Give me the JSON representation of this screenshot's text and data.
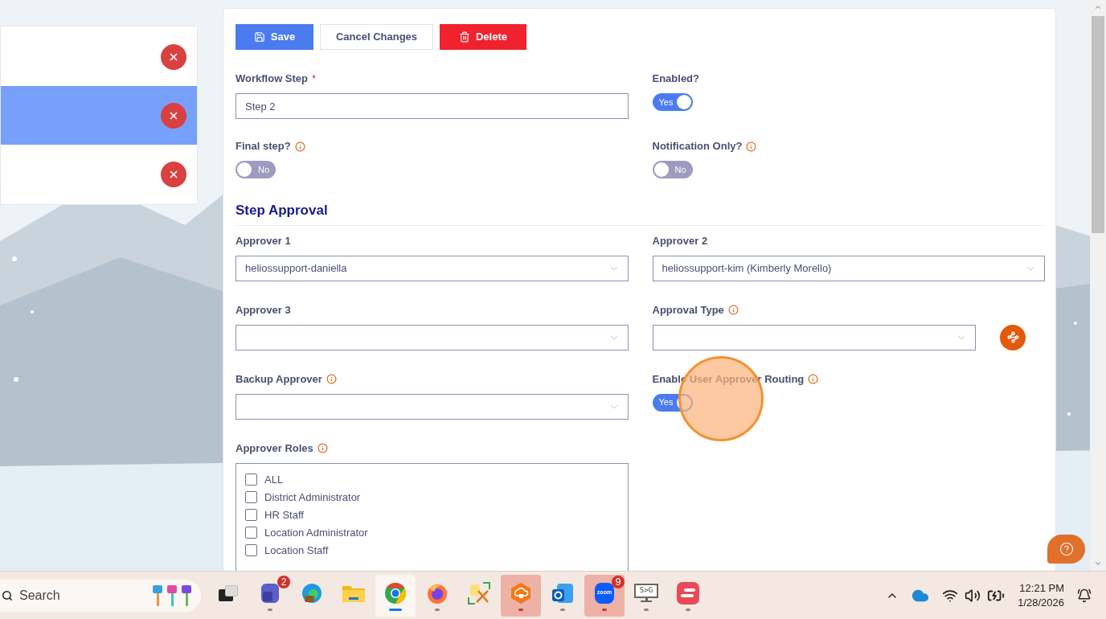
{
  "side_list": {
    "items": [
      {
        "selected": false
      },
      {
        "selected": true
      },
      {
        "selected": false
      }
    ]
  },
  "toolbar": [
    {
      "label": "Save",
      "kind": "primary"
    },
    {
      "label": "Cancel Changes",
      "kind": "secondary"
    },
    {
      "label": "Delete",
      "kind": "danger"
    }
  ],
  "general_fields": [
    {
      "label": "Workflow Step",
      "kind": "text",
      "required_mark": "*",
      "value": "Step 2"
    },
    {
      "label": "Enabled?",
      "kind": "toggle",
      "on": true,
      "toggle_text": "Yes"
    },
    {
      "label": "Final step?",
      "kind": "toggle",
      "info": true,
      "on": false,
      "toggle_text": "No"
    },
    {
      "label": "Notification Only?",
      "kind": "toggle",
      "info": true,
      "on": false,
      "toggle_text": "No"
    }
  ],
  "section_title": "Step Approval",
  "approval_fields": [
    {
      "label": "Approver 1",
      "kind": "select",
      "value": "heliossupport-daniella"
    },
    {
      "label": "Approver 2",
      "kind": "select",
      "value": "heliossupport-kim (Kimberly Morello)"
    },
    {
      "label": "Approver 3",
      "kind": "select"
    },
    {
      "label": "Approval Type",
      "kind": "select",
      "info": true,
      "action_button": true
    },
    {
      "label": "Backup Approver",
      "kind": "select",
      "info": true
    },
    {
      "label": "Enable User Approver Routing",
      "kind": "toggle",
      "info": true,
      "on": true,
      "toggle_text": "Yes"
    },
    {
      "label": "Approver Roles",
      "kind": "checklist",
      "info": true,
      "options": [
        {
          "label": "ALL",
          "checked": false
        },
        {
          "label": "District Administrator",
          "checked": false
        },
        {
          "label": "HR Staff",
          "checked": false
        },
        {
          "label": "Location Administrator",
          "checked": false
        },
        {
          "label": "Location Staff",
          "checked": false
        }
      ]
    }
  ],
  "taskbar": {
    "search_placeholder": "Search",
    "apps": [
      {
        "kind": "taskview",
        "running": false,
        "focused": false,
        "highlighted": false
      },
      {
        "kind": "teams",
        "running": true,
        "focused": false,
        "highlighted": false,
        "badge": "2"
      },
      {
        "kind": "edge",
        "running": false,
        "focused": false,
        "highlighted": false
      },
      {
        "kind": "explorer",
        "running": false,
        "focused": false,
        "highlighted": false
      },
      {
        "kind": "chrome",
        "running": true,
        "focused": true,
        "highlighted": false
      },
      {
        "kind": "firefox",
        "running": true,
        "focused": false,
        "highlighted": false
      },
      {
        "kind": "tool",
        "running": false,
        "focused": false,
        "highlighted": false
      },
      {
        "kind": "vpn",
        "running": true,
        "focused": false,
        "highlighted": true
      },
      {
        "kind": "outlook",
        "running": true,
        "focused": false,
        "highlighted": false
      },
      {
        "kind": "zoom",
        "running": true,
        "focused": false,
        "highlighted": true,
        "badge": "9",
        "icon_text": "zoom"
      },
      {
        "kind": "monitor",
        "running": true,
        "focused": false,
        "highlighted": false,
        "icon_text": "S>G"
      },
      {
        "kind": "redapp",
        "running": true,
        "focused": false,
        "highlighted": false
      }
    ],
    "clock": {
      "time": "12:21 PM",
      "date": "1/28/2026"
    }
  }
}
